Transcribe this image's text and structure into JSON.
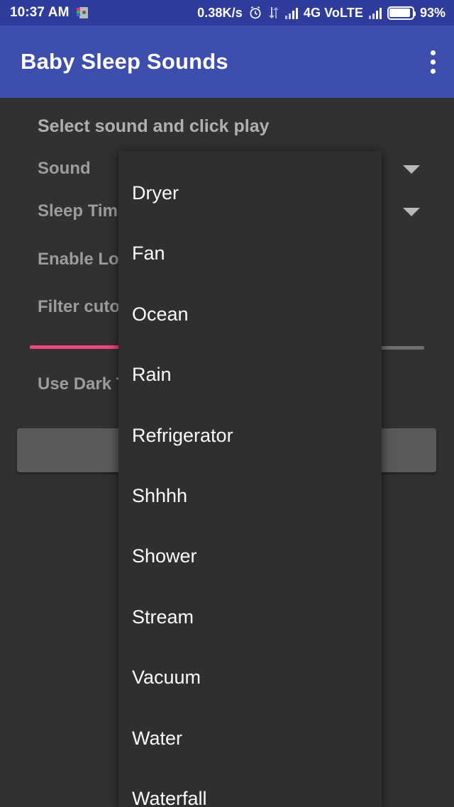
{
  "status_bar": {
    "time": "10:37 AM",
    "notification_icon": "app-notification-icon",
    "data_speed": "0.38K/s",
    "alarm_icon": "alarm-clock-icon",
    "sync_icon": "data-transfer-icon",
    "signal_icon_1": "signal-bars-icon",
    "network_label": "4G VoLTE",
    "signal_icon_2": "signal-bars-icon",
    "battery_icon": "battery-icon",
    "battery_percent": "93%",
    "background_color": "#2f3c9c"
  },
  "app_bar": {
    "title": "Baby Sleep Sounds",
    "overflow_icon": "more-vert-icon",
    "background_color": "#3d4ead"
  },
  "main": {
    "heading": "Select sound and click play",
    "rows": [
      {
        "label": "Sound",
        "control": "spinner",
        "arrow_icon": "chevron-down-icon"
      },
      {
        "label": "Sleep Timer",
        "control": "spinner",
        "arrow_icon": "chevron-down-icon"
      },
      {
        "label": "Enable Looping",
        "control": "switch"
      },
      {
        "label": "Filter cutoff",
        "control": "slider"
      },
      {
        "label": "Use Dark Theme",
        "control": "switch"
      }
    ],
    "slider": {
      "active_color": "#f0467d",
      "inactive_color": "#6e6e6e",
      "fill_percent": 24
    },
    "buttons": [
      {
        "label": ""
      },
      {
        "label": ""
      },
      {
        "label": ""
      }
    ],
    "background_color": "#333130"
  },
  "dropdown": {
    "name": "sound-spinner-dropdown",
    "background_color": "#2f2f2f",
    "items": [
      {
        "label": "Dryer"
      },
      {
        "label": "Fan"
      },
      {
        "label": "Ocean"
      },
      {
        "label": "Rain"
      },
      {
        "label": "Refrigerator"
      },
      {
        "label": "Shhhh"
      },
      {
        "label": "Shower"
      },
      {
        "label": "Stream"
      },
      {
        "label": "Vacuum"
      },
      {
        "label": "Water"
      },
      {
        "label": "Waterfall"
      }
    ]
  }
}
